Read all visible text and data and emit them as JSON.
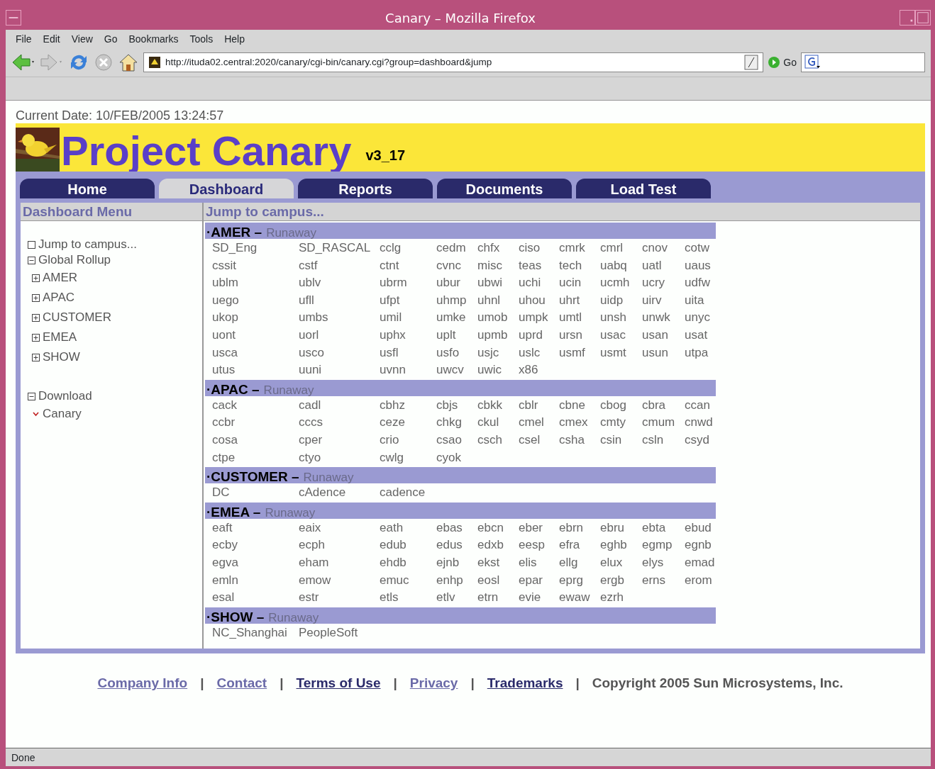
{
  "window": {
    "title": "Canary – Mozilla Firefox"
  },
  "menu_bar": [
    "File",
    "Edit",
    "View",
    "Go",
    "Bookmarks",
    "Tools",
    "Help"
  ],
  "toolbar": {
    "url": "http://ituda02.central:2020/canary/cgi-bin/canary.cgi?group=dashboard&jump",
    "go_label": "Go"
  },
  "page": {
    "current_date": "Current Date: 10/FEB/2005 13:24:57",
    "title": "Project Canary",
    "version": "v3_17",
    "nav_tabs": [
      {
        "label": "Home",
        "selected": false
      },
      {
        "label": "Dashboard",
        "selected": true
      },
      {
        "label": "Reports",
        "selected": false
      },
      {
        "label": "Documents",
        "selected": false
      },
      {
        "label": "Load Test",
        "selected": false
      }
    ],
    "sidebar": {
      "title": "Dashboard Menu",
      "sections": [
        [
          {
            "label": "Jump to campus...",
            "kind": "page"
          },
          {
            "label": "Global Rollup",
            "kind": "folder",
            "expanded": true,
            "children": [
              {
                "label": "AMER",
                "kind": "folder",
                "expanded": false
              },
              {
                "label": "APAC",
                "kind": "folder",
                "expanded": false
              },
              {
                "label": "CUSTOMER",
                "kind": "folder",
                "expanded": false
              },
              {
                "label": "EMEA",
                "kind": "folder",
                "expanded": false
              },
              {
                "label": "SHOW",
                "kind": "folder",
                "expanded": false
              }
            ]
          }
        ],
        [
          {
            "label": "Download",
            "kind": "folder",
            "expanded": true,
            "children": [
              {
                "label": "Canary",
                "kind": "download"
              }
            ]
          }
        ]
      ]
    },
    "content": {
      "title": "Jump to campus...",
      "groups": [
        {
          "name": "·AMER",
          "separator": "–",
          "status": "Runaway",
          "campuses": [
            "SD_Eng",
            "SD_RASCAL",
            "cclg",
            "cedm",
            "chfx",
            "ciso",
            "cmrk",
            "cmrl",
            "cnov",
            "cotw",
            "cssit",
            "cstf",
            "ctnt",
            "cvnc",
            "misc",
            "teas",
            "tech",
            "uabq",
            "uatl",
            "uaus",
            "ublm",
            "ublv",
            "ubrm",
            "ubur",
            "ubwi",
            "uchi",
            "ucin",
            "ucmh",
            "ucry",
            "udfw",
            "uego",
            "ufll",
            "ufpt",
            "uhmp",
            "uhnl",
            "uhou",
            "uhrt",
            "uidp",
            "uirv",
            "uita",
            "ukop",
            "umbs",
            "umil",
            "umke",
            "umob",
            "umpk",
            "umtl",
            "unsh",
            "unwk",
            "unyc",
            "uont",
            "uorl",
            "uphx",
            "uplt",
            "upmb",
            "uprd",
            "ursn",
            "usac",
            "usan",
            "usat",
            "usca",
            "usco",
            "usfl",
            "usfo",
            "usjc",
            "uslc",
            "usmf",
            "usmt",
            "usun",
            "utpa",
            "utus",
            "uuni",
            "uvnn",
            "uwcv",
            "uwic",
            "x86"
          ]
        },
        {
          "name": "·APAC",
          "separator": "–",
          "status": "Runaway",
          "campuses": [
            "cack",
            "cadl",
            "cbhz",
            "cbjs",
            "cbkk",
            "cblr",
            "cbne",
            "cbog",
            "cbra",
            "ccan",
            "ccbr",
            "cccs",
            "ceze",
            "chkg",
            "ckul",
            "cmel",
            "cmex",
            "cmty",
            "cmum",
            "cnwd",
            "cosa",
            "cper",
            "crio",
            "csao",
            "csch",
            "csel",
            "csha",
            "csin",
            "csln",
            "csyd",
            "ctpe",
            "ctyo",
            "cwlg",
            "cyok"
          ]
        },
        {
          "name": "·CUSTOMER",
          "separator": "–",
          "status": "Runaway",
          "campuses": [
            "DC",
            "cAdence",
            "cadence"
          ]
        },
        {
          "name": "·EMEA",
          "separator": "–",
          "status": "Runaway",
          "campuses": [
            "eaft",
            "eaix",
            "eath",
            "ebas",
            "ebcn",
            "eber",
            "ebrn",
            "ebru",
            "ebta",
            "ebud",
            "ecby",
            "ecph",
            "edub",
            "edus",
            "edxb",
            "eesp",
            "efra",
            "eghb",
            "egmp",
            "egnb",
            "egva",
            "eham",
            "ehdb",
            "ejnb",
            "ekst",
            "elis",
            "ellg",
            "elux",
            "elys",
            "emad",
            "emln",
            "emow",
            "emuc",
            "enhp",
            "eosl",
            "epar",
            "eprg",
            "ergb",
            "erns",
            "erom",
            "esal",
            "estr",
            "etls",
            "etlv",
            "etrn",
            "evie",
            "ewaw",
            "ezrh"
          ]
        },
        {
          "name": "·SHOW",
          "separator": "–",
          "status": "Runaway",
          "campuses": [
            "NC_Shanghai",
            "PeopleSoft"
          ]
        }
      ]
    },
    "footer": {
      "links": [
        {
          "label": "Company Info",
          "visited": true
        },
        {
          "label": "Contact",
          "visited": true
        },
        {
          "label": "Terms of Use",
          "visited": false
        },
        {
          "label": "Privacy",
          "visited": true
        },
        {
          "label": "Trademarks",
          "visited": false
        }
      ],
      "separator": "|",
      "copyright": "Copyright 2005 Sun Microsystems, Inc."
    }
  },
  "status_bar": "Done"
}
